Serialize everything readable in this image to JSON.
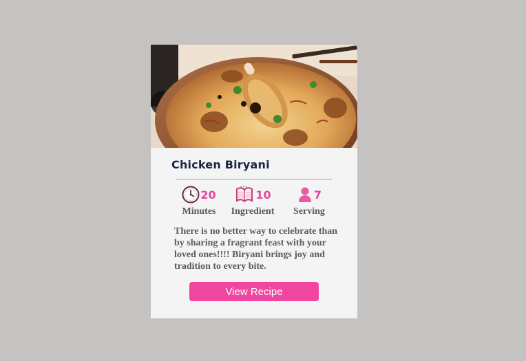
{
  "card": {
    "title": "Chicken Biryani",
    "stats": {
      "minutes": {
        "value": "20",
        "label": "Minutes",
        "icon": "clock-icon"
      },
      "ingredient": {
        "value": "10",
        "label": "Ingredient",
        "icon": "open-book-icon"
      },
      "serving": {
        "value": "7",
        "label": "Serving",
        "icon": "person-icon"
      }
    },
    "description": "There is no better way to celebrate than by sharing a fragrant feast with your loved ones!!!! Biryani brings joy and tradition to every bite.",
    "button_label": "View Recipe"
  },
  "colors": {
    "page_background": "#c4c3c1",
    "card_background": "#f4f4f4",
    "accent": "#f046a0",
    "stat_value": "#e5489b",
    "title": "#1c2442",
    "body_text": "#5b5b5b"
  },
  "image": {
    "subject": "plate of chicken biryani"
  }
}
